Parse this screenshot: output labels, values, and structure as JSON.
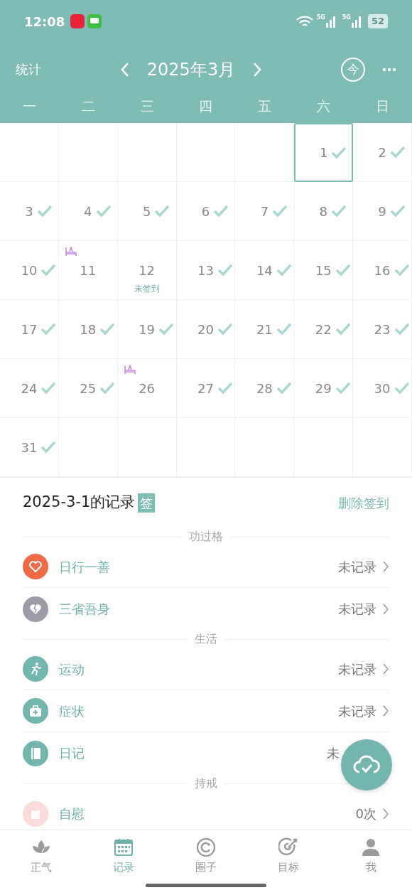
{
  "status_bar": {
    "time": "12:08",
    "network_1": "5G",
    "network_2": "5G",
    "battery": "52"
  },
  "header": {
    "left": "统计",
    "title": "2025年3月",
    "today": "今"
  },
  "weekdays": [
    "一",
    "二",
    "三",
    "四",
    "五",
    "六",
    "日"
  ],
  "calendar": [
    {
      "kind": "blank"
    },
    {
      "kind": "blank"
    },
    {
      "kind": "blank"
    },
    {
      "kind": "blank"
    },
    {
      "kind": "blank"
    },
    {
      "kind": "day",
      "day": "1",
      "checked": true,
      "selected": true,
      "marker": false
    },
    {
      "kind": "day",
      "day": "2",
      "checked": true,
      "selected": false,
      "marker": false
    },
    {
      "kind": "day",
      "day": "3",
      "checked": true,
      "selected": false,
      "marker": false
    },
    {
      "kind": "day",
      "day": "4",
      "checked": true,
      "selected": false,
      "marker": false
    },
    {
      "kind": "day",
      "day": "5",
      "checked": true,
      "selected": false,
      "marker": false
    },
    {
      "kind": "day",
      "day": "6",
      "checked": true,
      "selected": false,
      "marker": false
    },
    {
      "kind": "day",
      "day": "7",
      "checked": true,
      "selected": false,
      "marker": false
    },
    {
      "kind": "day",
      "day": "8",
      "checked": true,
      "selected": false,
      "marker": false
    },
    {
      "kind": "day",
      "day": "9",
      "checked": true,
      "selected": false,
      "marker": false
    },
    {
      "kind": "day",
      "day": "10",
      "checked": true,
      "selected": false,
      "marker": false
    },
    {
      "kind": "day",
      "day": "11",
      "checked": false,
      "selected": false,
      "marker": true
    },
    {
      "kind": "day",
      "day": "12",
      "checked": false,
      "selected": false,
      "marker": false,
      "note": "未签到"
    },
    {
      "kind": "day",
      "day": "13",
      "checked": true,
      "selected": false,
      "marker": false
    },
    {
      "kind": "day",
      "day": "14",
      "checked": true,
      "selected": false,
      "marker": false
    },
    {
      "kind": "day",
      "day": "15",
      "checked": true,
      "selected": false,
      "marker": false
    },
    {
      "kind": "day",
      "day": "16",
      "checked": true,
      "selected": false,
      "marker": false
    },
    {
      "kind": "day",
      "day": "17",
      "checked": true,
      "selected": false,
      "marker": false
    },
    {
      "kind": "day",
      "day": "18",
      "checked": true,
      "selected": false,
      "marker": false
    },
    {
      "kind": "day",
      "day": "19",
      "checked": true,
      "selected": false,
      "marker": false
    },
    {
      "kind": "day",
      "day": "20",
      "checked": true,
      "selected": false,
      "marker": false
    },
    {
      "kind": "day",
      "day": "21",
      "checked": true,
      "selected": false,
      "marker": false
    },
    {
      "kind": "day",
      "day": "22",
      "checked": true,
      "selected": false,
      "marker": false
    },
    {
      "kind": "day",
      "day": "23",
      "checked": true,
      "selected": false,
      "marker": false
    },
    {
      "kind": "day",
      "day": "24",
      "checked": true,
      "selected": false,
      "marker": false
    },
    {
      "kind": "day",
      "day": "25",
      "checked": true,
      "selected": false,
      "marker": false
    },
    {
      "kind": "day",
      "day": "26",
      "checked": false,
      "selected": false,
      "marker": true
    },
    {
      "kind": "day",
      "day": "27",
      "checked": true,
      "selected": false,
      "marker": false
    },
    {
      "kind": "day",
      "day": "28",
      "checked": true,
      "selected": false,
      "marker": false
    },
    {
      "kind": "day",
      "day": "29",
      "checked": true,
      "selected": false,
      "marker": false
    },
    {
      "kind": "day",
      "day": "30",
      "checked": true,
      "selected": false,
      "marker": false
    },
    {
      "kind": "day",
      "day": "31",
      "checked": true,
      "selected": false,
      "marker": false
    },
    {
      "kind": "blank"
    },
    {
      "kind": "blank"
    },
    {
      "kind": "blank"
    },
    {
      "kind": "blank"
    },
    {
      "kind": "blank"
    },
    {
      "kind": "blank"
    }
  ],
  "record": {
    "title": "2025-3-1的记录",
    "badge": "签",
    "action": "删除签到",
    "sections": [
      {
        "title": "功过格",
        "items": [
          {
            "kind": "heart",
            "color": "#ef6a47",
            "label": "日行一善",
            "value": "未记录",
            "chevron": true
          },
          {
            "kind": "broken-heart",
            "color": "#9d9ca6",
            "label": "三省吾身",
            "value": "未记录",
            "chevron": true
          }
        ]
      },
      {
        "title": "生活",
        "items": [
          {
            "kind": "runner",
            "color": "#73b6ad",
            "label": "运动",
            "value": "未记录",
            "chevron": true
          },
          {
            "kind": "medkit",
            "color": "#73b6ad",
            "label": "症状",
            "value": "未记录",
            "chevron": true
          },
          {
            "kind": "notebook",
            "color": "#73b6ad",
            "label": "日记",
            "value": "未",
            "chevron": false
          }
        ]
      },
      {
        "title": "持戒",
        "items": [
          {
            "kind": "roll",
            "color": "#fbdada",
            "label": "自慰",
            "value": "0次",
            "chevron": true
          }
        ]
      }
    ]
  },
  "tabs": [
    {
      "kind": "lotus",
      "label": "正气",
      "selected": false
    },
    {
      "kind": "calendar",
      "label": "记录",
      "selected": true
    },
    {
      "kind": "ring",
      "label": "圈子",
      "selected": false
    },
    {
      "kind": "target",
      "label": "目标",
      "selected": false
    },
    {
      "kind": "person",
      "label": "我",
      "selected": false
    }
  ]
}
